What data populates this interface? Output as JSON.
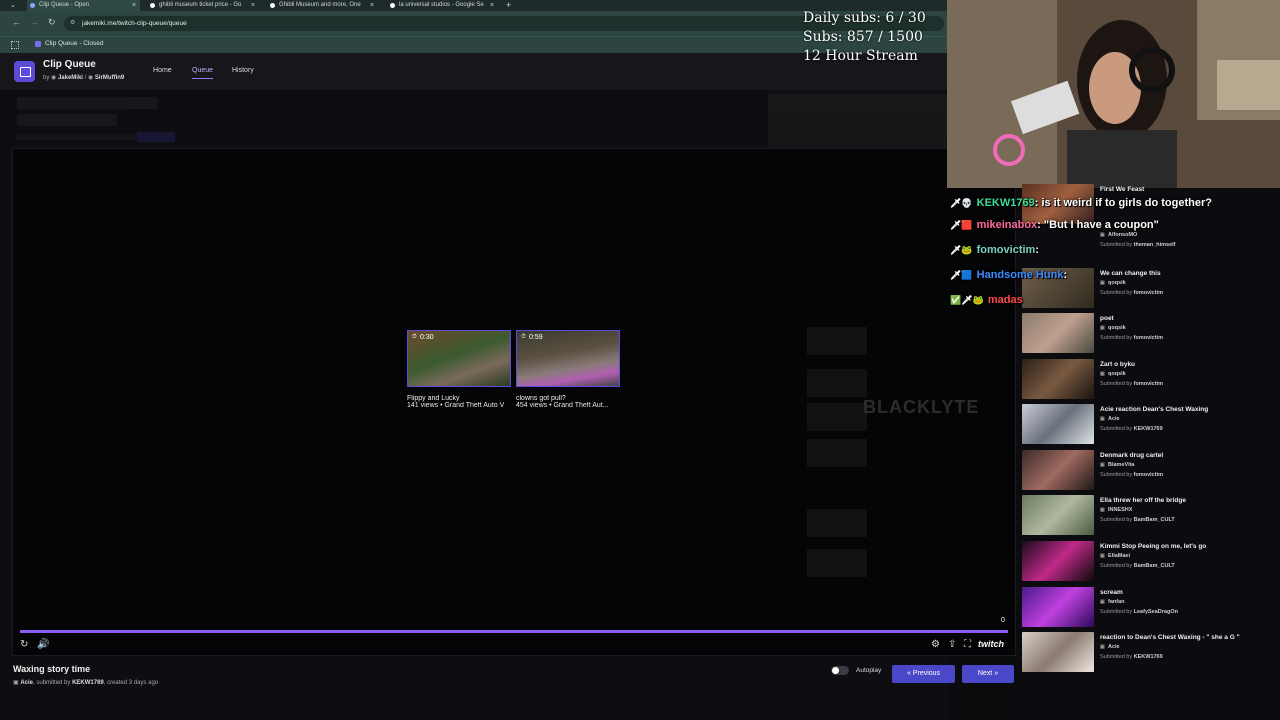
{
  "browser": {
    "tabs": [
      {
        "label": "Clip Queue - Open",
        "active": true
      },
      {
        "label": "ghibli museum ticket price - Go",
        "active": false
      },
      {
        "label": "Ghibli Museum and more, One",
        "active": false
      },
      {
        "label": "la universal studios - Google Se",
        "active": false
      }
    ],
    "new_tab_label": "+",
    "url": "jakemiki.me/twitch-clip-queue/queue",
    "bookmark": "Clip Queue - Closed"
  },
  "app": {
    "title": "Clip Queue",
    "by_label": "by",
    "authors": [
      "JakeMiki",
      "SirMuffin9"
    ],
    "author_sep": "/",
    "nav": [
      "Home",
      "Queue",
      "History"
    ]
  },
  "overlay": {
    "daily_subs": "Daily subs: 6 / 30",
    "subs": "Subs: 857 / 1500",
    "stream_label": "12 Hour Stream"
  },
  "player": {
    "clips": [
      {
        "duration": "0:30",
        "title": "Flippy and Lucky",
        "meta": "141 views • Grand Theft Auto V"
      },
      {
        "duration": "0:59",
        "title": "clowns got pull?",
        "meta": "454 views • Grand Theft Aut..."
      }
    ],
    "progress": 1.0,
    "volume_readout": "0",
    "brand": "twitch"
  },
  "current_clip": {
    "title": "Waxing story time",
    "channel": "Acie",
    "submitted_by_label": ", submitted by",
    "submitter": "KEKW1769",
    "created": ", created 3 days ago"
  },
  "controls": {
    "autoplay_label": "Autoplay",
    "autoplay_on": false,
    "previous_label": "Previous",
    "next_label": "Next"
  },
  "chat": [
    {
      "badges": "🗡💀",
      "user": "KEKW1769",
      "user_color": "#3ddc97",
      "message": "is it weird if to girls do together?"
    },
    {
      "badges": "🗡🟥",
      "user": "mikeinabox",
      "user_color": "#ff6aa0",
      "message": "\"But I have a coupon\""
    },
    {
      "badges": "🗡🐸",
      "user": "fomovictim",
      "user_color": "#7ad0c4",
      "message": ""
    },
    {
      "badges": "🗡🟦",
      "user": "Handsome Hunk",
      "user_color": "#3a8bff",
      "message": ""
    },
    {
      "badges": "✅🗡🐸",
      "user": "madas",
      "user_color": "#ff4a4a",
      "message": ""
    }
  ],
  "queue": [
    {
      "title": "First We Feast",
      "channel": "AlfonsoMO",
      "submitter": "theman_himself"
    },
    {
      "title": "We can change this",
      "channel": "qoqsik",
      "submitter": "fomovictim"
    },
    {
      "title": "poet",
      "channel": "qoqsik",
      "submitter": "fomovictim"
    },
    {
      "title": "Zart o byku",
      "channel": "qoqsik",
      "submitter": "fomovictim"
    },
    {
      "title": "Acie reaction Dean's Chest Waxing",
      "channel": "Acie",
      "submitter": "KEKW1769"
    },
    {
      "title": "Denmark drug cartel",
      "channel": "BlameVita",
      "submitter": "fomovictim"
    },
    {
      "title": "Ella threw her off the bridge",
      "channel": "INNESHX",
      "submitter": "BamBam_CULT"
    },
    {
      "title": "Kimmi Stop Peeing on me, let's go",
      "channel": "EllaMaei",
      "submitter": "BamBam_CULT"
    },
    {
      "title": "scream",
      "channel": "fanfan",
      "submitter": "LeafySeaDragOn"
    },
    {
      "title": "reaction to Dean's Chest Waxing - \" she a G \"",
      "channel": "Acie",
      "submitter": "KEKW1769"
    }
  ],
  "submitted_by_prefix": "Submitted by",
  "colors": {
    "accent": "#5b4bd6",
    "button": "#4a47c9",
    "progress": "#8b5cf6"
  }
}
